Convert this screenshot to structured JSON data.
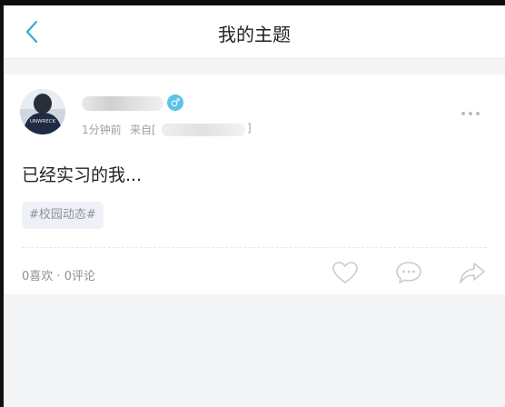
{
  "header": {
    "title": "我的主题"
  },
  "post": {
    "time": "1分钟前",
    "from_label": "来自[",
    "from_bracket_close": "]",
    "gender_symbol": "♂",
    "content": "已经实习的我...",
    "tag": "#校园动态#",
    "likes": "0喜欢",
    "separator": " · ",
    "comments": "0评论",
    "avatar_shirt_text": "UNWRECK"
  },
  "colors": {
    "accent": "#3aa7dd",
    "gender_badge": "#5dc2ea",
    "muted_text": "#9aa0a6",
    "page_bg": "#f2f4f6"
  },
  "icons": {
    "back": "chevron-left-icon",
    "more": "more-dots-icon",
    "like": "heart-icon",
    "comment": "comment-bubble-icon",
    "share": "share-arrow-icon"
  }
}
